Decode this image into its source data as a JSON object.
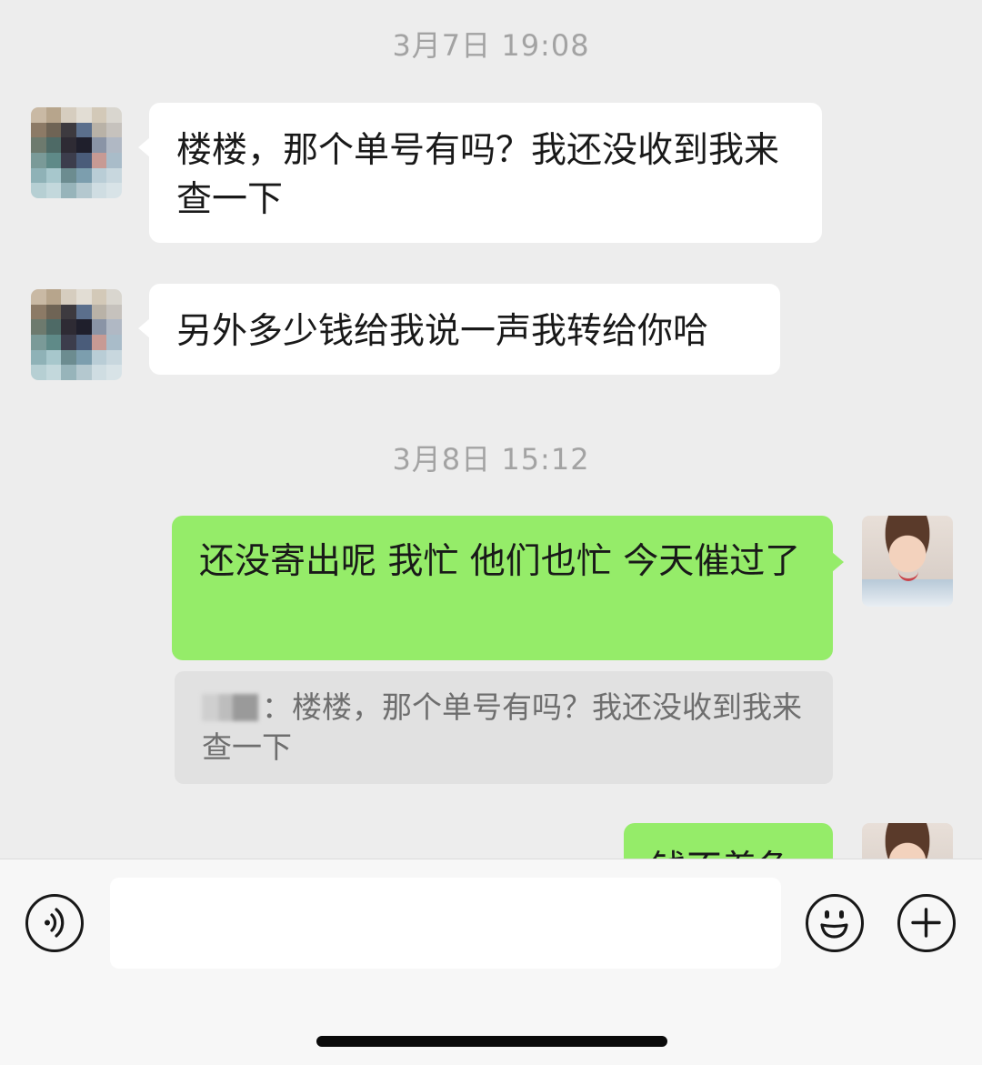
{
  "timestamps": [
    "3月7日 19:08",
    "3月8日 15:12"
  ],
  "messages": [
    {
      "side": "incoming",
      "text": "楼楼，那个单号有吗？我还没收到我来查一下"
    },
    {
      "side": "incoming",
      "text": "另外多少钱给我说一声我转给你哈"
    },
    {
      "side": "outgoing",
      "text": "还没寄出呢 我忙 他们也忙 今天催过了"
    },
    {
      "side": "outgoing",
      "text": "钱不着急"
    }
  ],
  "quote": {
    "separator": "：",
    "text": "楼楼，那个单号有吗？我还没收到我来查一下"
  },
  "input": {
    "value": ""
  },
  "icons": [
    "voice-icon",
    "emoji-icon",
    "plus-icon"
  ],
  "colors": {
    "background": "#ededed",
    "outgoing_bubble": "#95ec69",
    "incoming_bubble": "#ffffff"
  }
}
